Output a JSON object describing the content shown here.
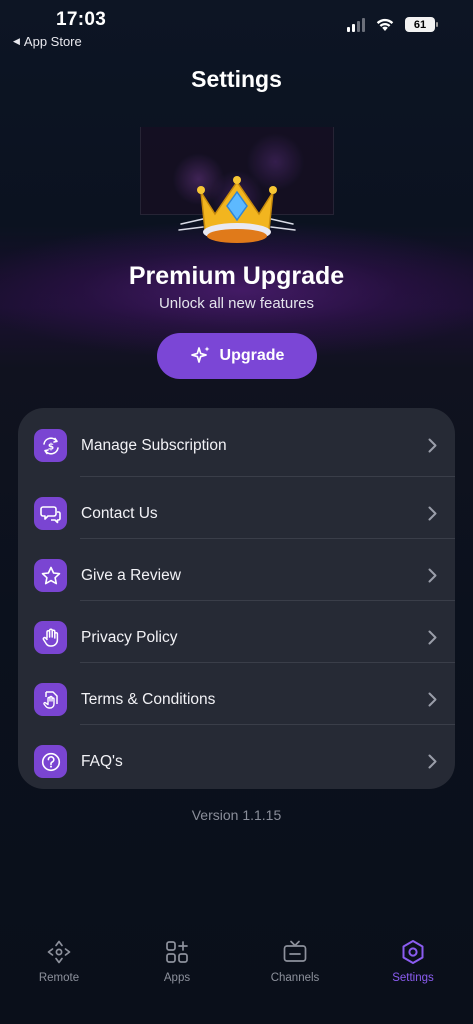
{
  "status_bar": {
    "time": "17:03",
    "back_label": "App Store",
    "battery": "61"
  },
  "page": {
    "title": "Settings"
  },
  "promo": {
    "title": "Premium Upgrade",
    "subtitle": "Unlock all new features",
    "button_label": "Upgrade",
    "accent_color": "#7b46d6"
  },
  "menu": {
    "items": [
      {
        "label": "Manage Subscription",
        "icon": "subscription-dollar-icon"
      },
      {
        "label": "Contact Us",
        "icon": "chat-bubbles-icon"
      },
      {
        "label": "Give a Review",
        "icon": "star-icon"
      },
      {
        "label": "Privacy Policy",
        "icon": "hand-icon"
      },
      {
        "label": "Terms & Conditions",
        "icon": "document-hand-icon"
      },
      {
        "label": "FAQ's",
        "icon": "question-circle-icon"
      }
    ]
  },
  "version_text": "Version  1.1.15",
  "tabbar": {
    "tabs": [
      {
        "label": "Remote",
        "icon": "remote-dpad-icon",
        "active": false
      },
      {
        "label": "Apps",
        "icon": "apps-grid-icon",
        "active": false
      },
      {
        "label": "Channels",
        "icon": "tv-icon",
        "active": false
      },
      {
        "label": "Settings",
        "icon": "settings-hex-icon",
        "active": true
      }
    ],
    "active_color": "#8b5cf0",
    "inactive_color": "#8d919c"
  }
}
